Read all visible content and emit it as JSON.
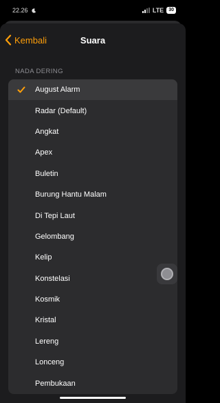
{
  "status": {
    "time": "22.26",
    "network": "LTE",
    "battery": "30"
  },
  "nav": {
    "back_label": "Kembali",
    "title": "Suara"
  },
  "section_header": "NADA DERING",
  "ringtones": [
    {
      "label": "August Alarm",
      "selected": true
    },
    {
      "label": "Radar (Default)",
      "selected": false
    },
    {
      "label": "Angkat",
      "selected": false
    },
    {
      "label": "Apex",
      "selected": false
    },
    {
      "label": "Buletin",
      "selected": false
    },
    {
      "label": "Burung Hantu Malam",
      "selected": false
    },
    {
      "label": "Di Tepi Laut",
      "selected": false
    },
    {
      "label": "Gelombang",
      "selected": false
    },
    {
      "label": "Kelip",
      "selected": false
    },
    {
      "label": "Konstelasi",
      "selected": false
    },
    {
      "label": "Kosmik",
      "selected": false
    },
    {
      "label": "Kristal",
      "selected": false
    },
    {
      "label": "Lereng",
      "selected": false
    },
    {
      "label": "Lonceng",
      "selected": false
    },
    {
      "label": "Pembukaan",
      "selected": false
    }
  ],
  "colors": {
    "accent": "#ff9f0a",
    "background": "#1c1c1e",
    "list_background": "#2c2c2e"
  }
}
